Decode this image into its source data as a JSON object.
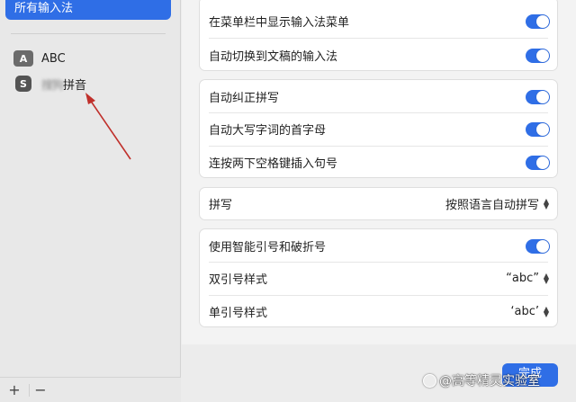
{
  "sidebar": {
    "selected_label": "所有输入法",
    "sources": [
      {
        "icon_text": "A",
        "icon_name": "abc-keyboard-icon",
        "label": "ABC"
      },
      {
        "icon_text": "S",
        "icon_name": "sogou-icon",
        "label_blurred": "搜狗",
        "label": "拼音"
      }
    ],
    "footer": {
      "add": "+",
      "remove": "−"
    }
  },
  "settings": {
    "group1": [
      {
        "label": "在菜单栏中显示输入法菜单",
        "on": true
      },
      {
        "label": "自动切换到文稿的输入法",
        "on": true
      }
    ],
    "group2": [
      {
        "label": "自动纠正拼写",
        "on": true
      },
      {
        "label": "自动大写字词的首字母",
        "on": true
      },
      {
        "label": "连按两下空格键插入句号",
        "on": true
      }
    ],
    "spelling": {
      "label": "拼写",
      "value": "按照语言自动拼写"
    },
    "group4": {
      "smart_quotes": {
        "label": "使用智能引号和破折号",
        "on": true
      },
      "double_quotes": {
        "label": "双引号样式",
        "value": "“abc”"
      },
      "single_quotes": {
        "label": "单引号样式",
        "value": "‘abc’"
      }
    }
  },
  "done_label": "完成",
  "watermark": "@高等精灵实验室",
  "colors": {
    "accent": "#2f6ee6",
    "annotation_arrow": "#c0302b"
  }
}
